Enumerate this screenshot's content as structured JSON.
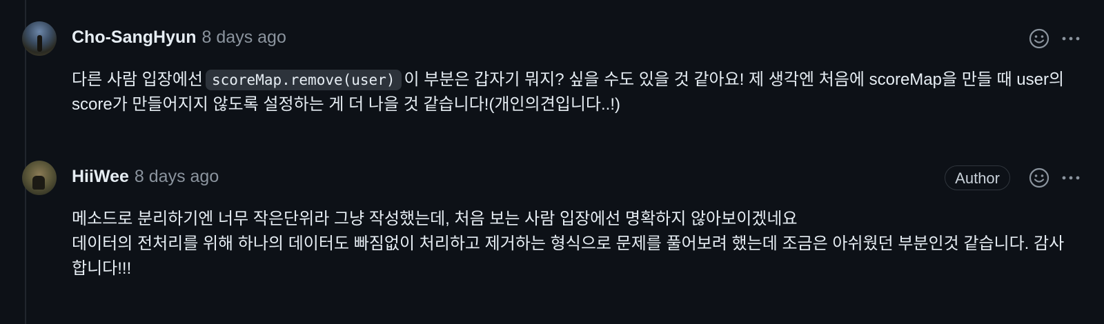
{
  "comments": [
    {
      "author": "Cho-SangHyun",
      "time": "8 days ago",
      "badge": "",
      "body": {
        "before_code": "다른 사람 입장에선",
        "code": "scoreMap.remove(user)",
        "after_code": "이 부분은 갑자기 뭐지? 싶을 수도 있을 것 같아요! 제 생각엔 처음에 scoreMap을 만들 때 user의 score가 만들어지지 않도록 설정하는 게 더 나을 것 같습니다!(개인의견입니다..!)"
      }
    },
    {
      "author": "HiiWee",
      "time": "8 days ago",
      "badge": "Author",
      "body": {
        "line1": "메소드로 분리하기엔 너무 작은단위라 그냥 작성했는데, 처음 보는 사람 입장에선 명확하지 않아보이겠네요",
        "line2": "데이터의 전처리를 위해 하나의 데이터도 빠짐없이 처리하고 제거하는 형식으로 문제를 풀어보려 했는데 조금은 아쉬웠던 부분인것 같습니다. 감사합니다!!!"
      }
    }
  ],
  "icons": {
    "reaction": "smiley-icon",
    "menu": "kebab-menu-icon"
  },
  "colors": {
    "background": "#0d1117",
    "text": "#e6edf3",
    "muted": "#8b949e",
    "border": "#30363d",
    "code_bg": "#2d333b"
  }
}
